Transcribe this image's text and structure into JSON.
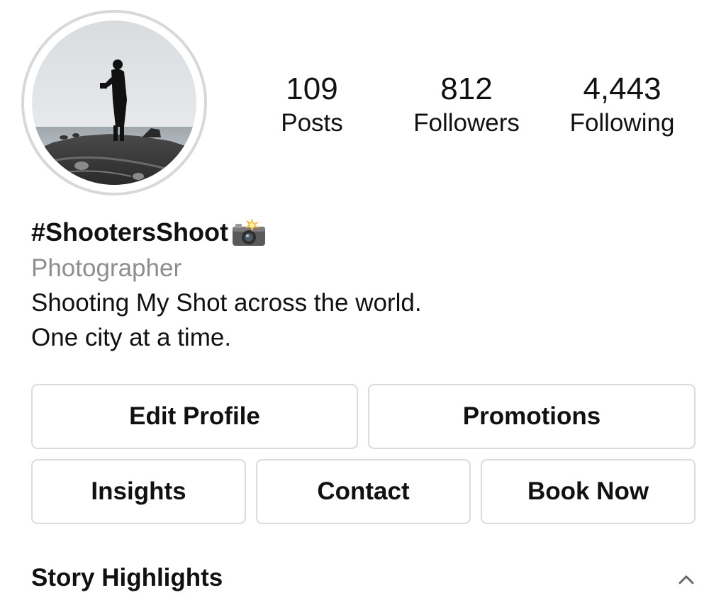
{
  "profile": {
    "stats": [
      {
        "value": "109",
        "label": "Posts"
      },
      {
        "value": "812",
        "label": "Followers"
      },
      {
        "value": "4,443",
        "label": "Following"
      }
    ],
    "username": "#ShootersShoot",
    "username_icon": "camera-flash-icon",
    "category": "Photographer",
    "bio": [
      "Shooting My Shot across the world.",
      "One city at a time."
    ]
  },
  "actions": {
    "edit_profile": "Edit Profile",
    "promotions": "Promotions",
    "insights": "Insights",
    "contact": "Contact",
    "book_now": "Book Now"
  },
  "highlights": {
    "title": "Story Highlights",
    "toggle_icon": "chevron-up-icon"
  },
  "colors": {
    "text": "#111111",
    "secondary_text": "#8e8e8e",
    "border": "#dbdbdb",
    "avatar_ring": "#d8d8d8"
  }
}
